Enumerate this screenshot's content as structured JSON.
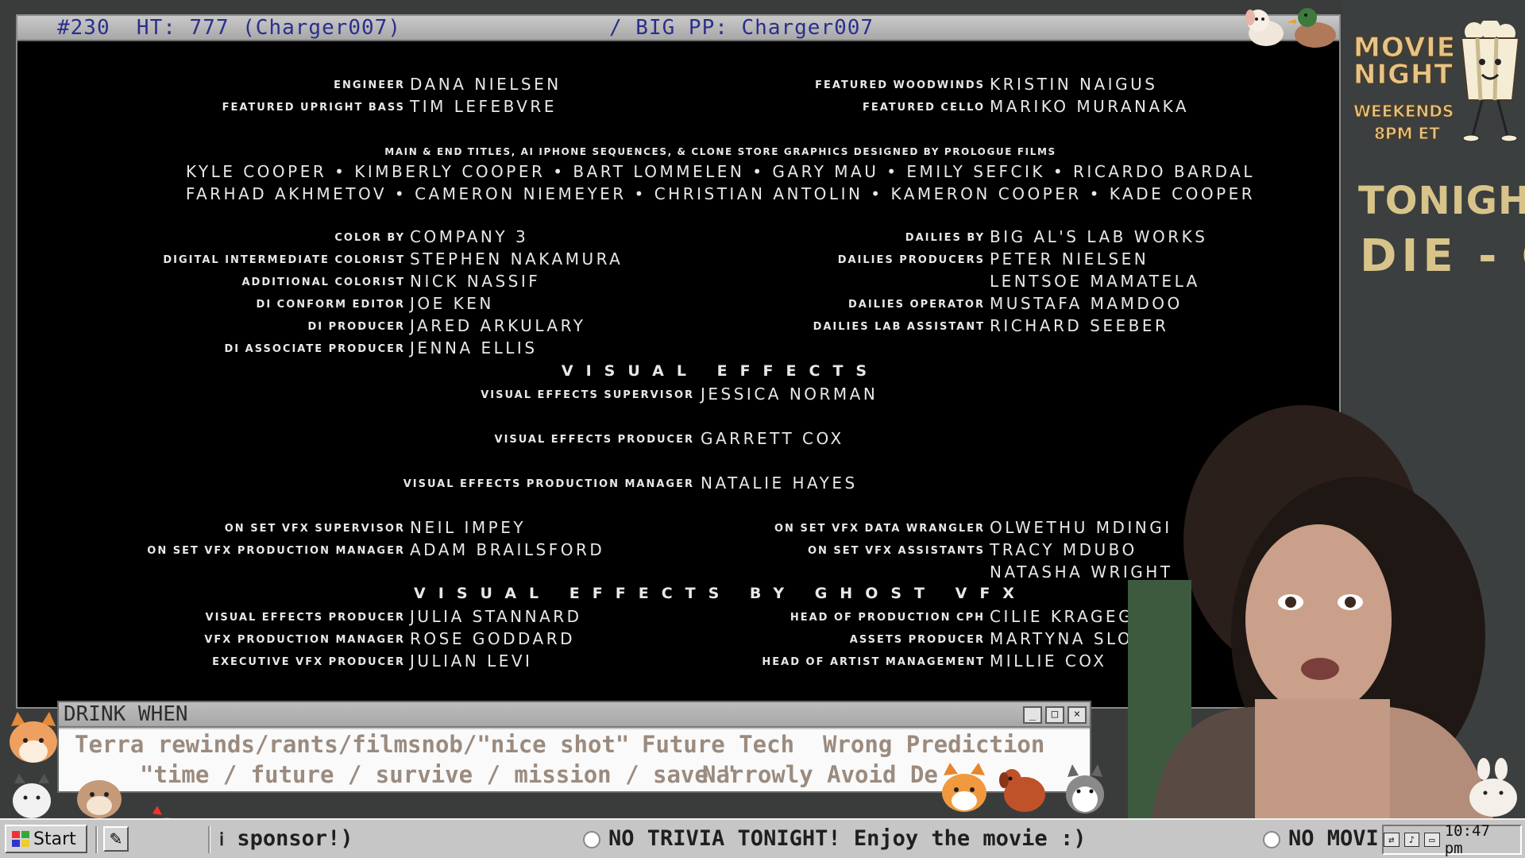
{
  "player": {
    "title_left": "#230  HT: 777 (Charger007)",
    "title_right": "/ BIG PP: Charger007"
  },
  "credits": {
    "left_top": [
      {
        "role": "Engineer",
        "name": "DANA NIELSEN"
      },
      {
        "role": "Featured Upright Bass",
        "name": "TIM LEFEBVRE"
      }
    ],
    "right_top": [
      {
        "role": "Featured Woodwinds",
        "name": "KRISTIN NAIGUS"
      },
      {
        "role": "Featured Cello",
        "name": "MARIKO MURANAKA"
      }
    ],
    "titles_role": "Main & End Titles, AI iPhone Sequences, & Clone Store Graphics Designed by Prologue Films",
    "titles_line1": "KYLE COOPER • KIMBERLY COOPER • BART LOMMELEN • GARY MAU • EMILY SEFCIK • RICARDO BARDAL",
    "titles_line2": "FARHAD AKHMETOV • CAMERON NIEMEYER • CHRISTIAN ANTOLIN • KAMERON COOPER • KADE COOPER",
    "left_mid": [
      {
        "role": "Color by",
        "name": "COMPANY 3"
      },
      {
        "role": "Digital Intermediate Colorist",
        "name": "STEPHEN NAKAMURA"
      },
      {
        "role": "Additional Colorist",
        "name": "NICK NASSIF"
      },
      {
        "role": "DI Conform Editor",
        "name": "JOE KEN"
      },
      {
        "role": "DI Producer",
        "name": "JARED ARKULARY"
      },
      {
        "role": "DI Associate Producer",
        "name": "JENNA ELLIS"
      }
    ],
    "right_mid": [
      {
        "role": "Dailies by",
        "name": "BIG AL'S LAB WORKS"
      },
      {
        "role": "Dailies Producers",
        "name": "PETER NIELSEN"
      },
      {
        "role": "",
        "name": "LENTSOE MAMATELA"
      },
      {
        "role": "Dailies Operator",
        "name": "MUSTAFA MAMDOO"
      },
      {
        "role": "Dailies Lab Assistant",
        "name": "RICHARD SEEBER"
      }
    ],
    "vfx_heading": "VISUAL EFFECTS",
    "vfx_center": [
      {
        "role": "Visual Effects Supervisor",
        "name": "JESSICA NORMAN"
      },
      {
        "role": "Visual Effects Producer",
        "name": "GARRETT COX"
      },
      {
        "role": "Visual Effects Production Manager",
        "name": "NATALIE HAYES"
      }
    ],
    "onset_left": [
      {
        "role": "On Set VFX Supervisor",
        "name": "NEIL IMPEY"
      },
      {
        "role": "On Set VFX Production Manager",
        "name": "ADAM BRAILSFORD"
      }
    ],
    "onset_right": [
      {
        "role": "On Set VFX Data Wrangler",
        "name": "OLWETHU MDINGI"
      },
      {
        "role": "On Set VFX Assistants",
        "name": "TRACY MDUBO"
      },
      {
        "role": "",
        "name": "NATASHA WRIGHT"
      }
    ],
    "ghost_heading": "VISUAL EFFECTS BY GHOST VFX",
    "ghost_left": [
      {
        "role": "Visual Effects Producer",
        "name": "JULIA STANNARD"
      },
      {
        "role": "VFX Production Manager",
        "name": "ROSE GODDARD"
      },
      {
        "role": "Executive VFX Producer",
        "name": "JULIAN LEVI"
      }
    ],
    "ghost_right": [
      {
        "role": "Head of Production CPH",
        "name": "CILIE KRAGEG"
      },
      {
        "role": "Assets Producer",
        "name": "MARTYNA SLO"
      },
      {
        "role": "Head of Artist Management",
        "name": "MILLIE COX"
      }
    ]
  },
  "sidebar": {
    "logo_line1": "MOVIE",
    "logo_line2": "NIGHT",
    "logo_line3": "WEEKENDS",
    "logo_line4": "8PM ET",
    "tonight_label": "TONIGHT:",
    "tonight_movie": "DIE - G"
  },
  "drink_when": {
    "title": "DRINK WHEN",
    "row1_left": "Terra rewinds/rants/filmsnob/\"nice shot\"",
    "row1_mid": "Future Tech",
    "row1_right": "Wrong Prediction",
    "row2_left": "\"time / future / survive / mission / save \"",
    "row2_right": "Narrowly Avoid De"
  },
  "taskbar": {
    "start_label": "Start",
    "ticker_left": "sponsor!)",
    "ticker_mid": "NO TRIVIA TONIGHT! Enjoy the movie :)",
    "ticker_right": "NO MOVI",
    "clock": "10:47 pm"
  },
  "colors": {
    "titlebar_text": "#2a2f8c",
    "drink_text": "#9b8b7f",
    "sidebar_gold": "#d8c48a"
  },
  "icons": [
    "crown-icon",
    "minimize-icon",
    "maximize-icon",
    "close-icon",
    "windows-logo-icon",
    "notepad-icon",
    "network-icon",
    "volume-icon",
    "monitor-icon"
  ]
}
